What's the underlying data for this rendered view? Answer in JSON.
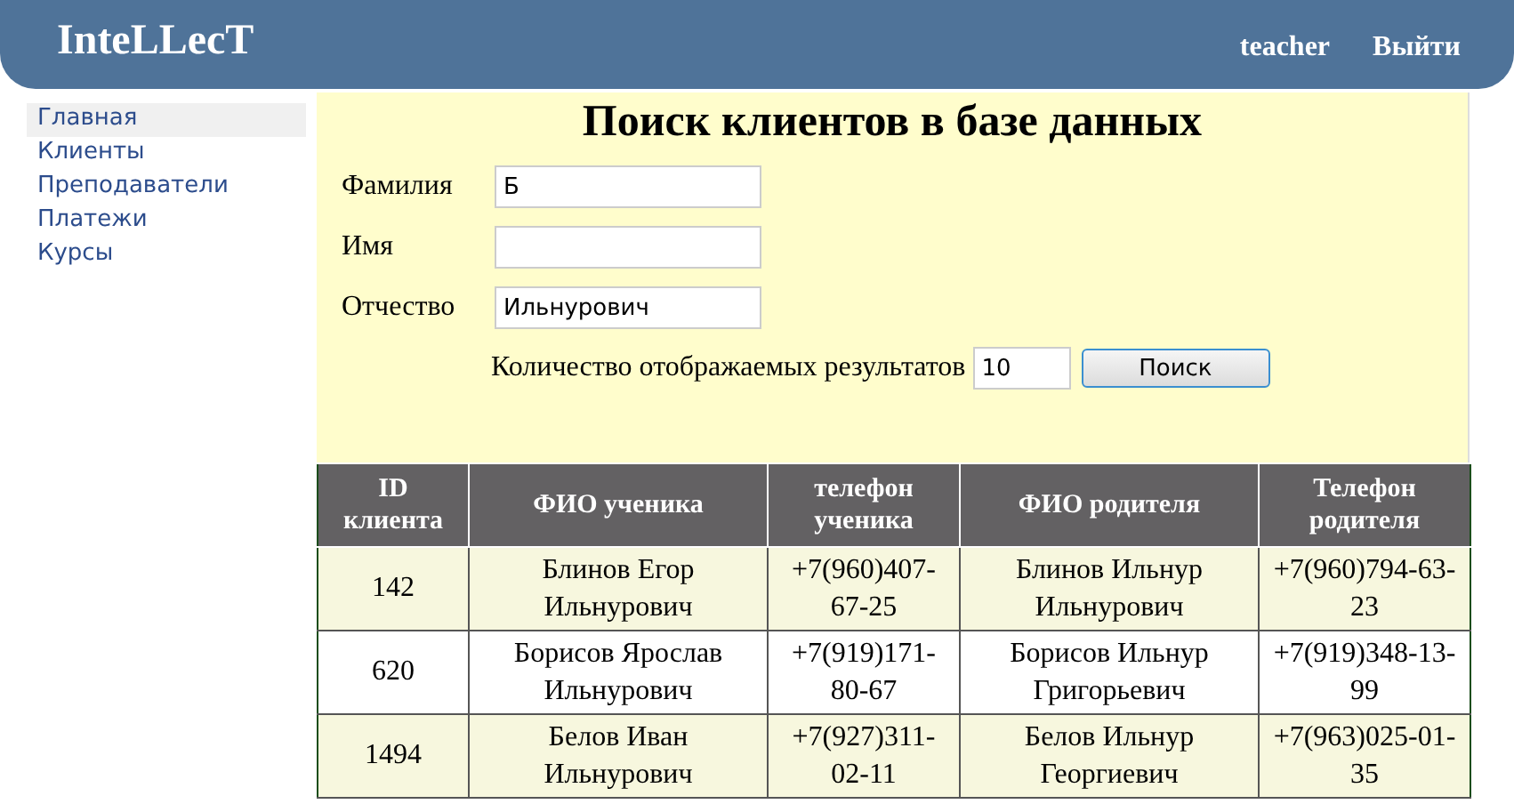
{
  "header": {
    "logo": "InteLLecT",
    "user": "teacher",
    "logout": "Выйти"
  },
  "sidebar": {
    "items": [
      {
        "label": "Главная",
        "selected": true
      },
      {
        "label": "Клиенты",
        "selected": false
      },
      {
        "label": "Преподаватели",
        "selected": false
      },
      {
        "label": "Платежи",
        "selected": false
      },
      {
        "label": "Курсы",
        "selected": false
      }
    ]
  },
  "search": {
    "title": "Поиск клиентов в базе данных",
    "fields": [
      {
        "label": "Фамилия",
        "value": "Б"
      },
      {
        "label": "Имя"
      },
      {
        "label": "Отчество",
        "value": "Ильнурович"
      }
    ],
    "count_label": "Количество отображаемых результатов",
    "count_value": "10",
    "button": "Поиск"
  },
  "table": {
    "columns": [
      "ID клиента",
      "ФИО ученика",
      "телефон ученика",
      "ФИО родителя",
      "Телефон родителя"
    ],
    "rows": [
      [
        "142",
        "Блинов Егор Ильнурович",
        "+7(960)407-67-25",
        "Блинов Ильнур Ильнурович",
        "+7(960)794-63-23"
      ],
      [
        "620",
        "Борисов Ярослав Ильнурович",
        "+7(919)171-80-67",
        "Борисов Ильнур Григорьевич",
        "+7(919)348-13-99"
      ],
      [
        "1494",
        "Белов Иван Ильнурович",
        "+7(927)311-02-11",
        "Белов Ильнур Георгиевич",
        "+7(963)025-01-35"
      ]
    ]
  }
}
